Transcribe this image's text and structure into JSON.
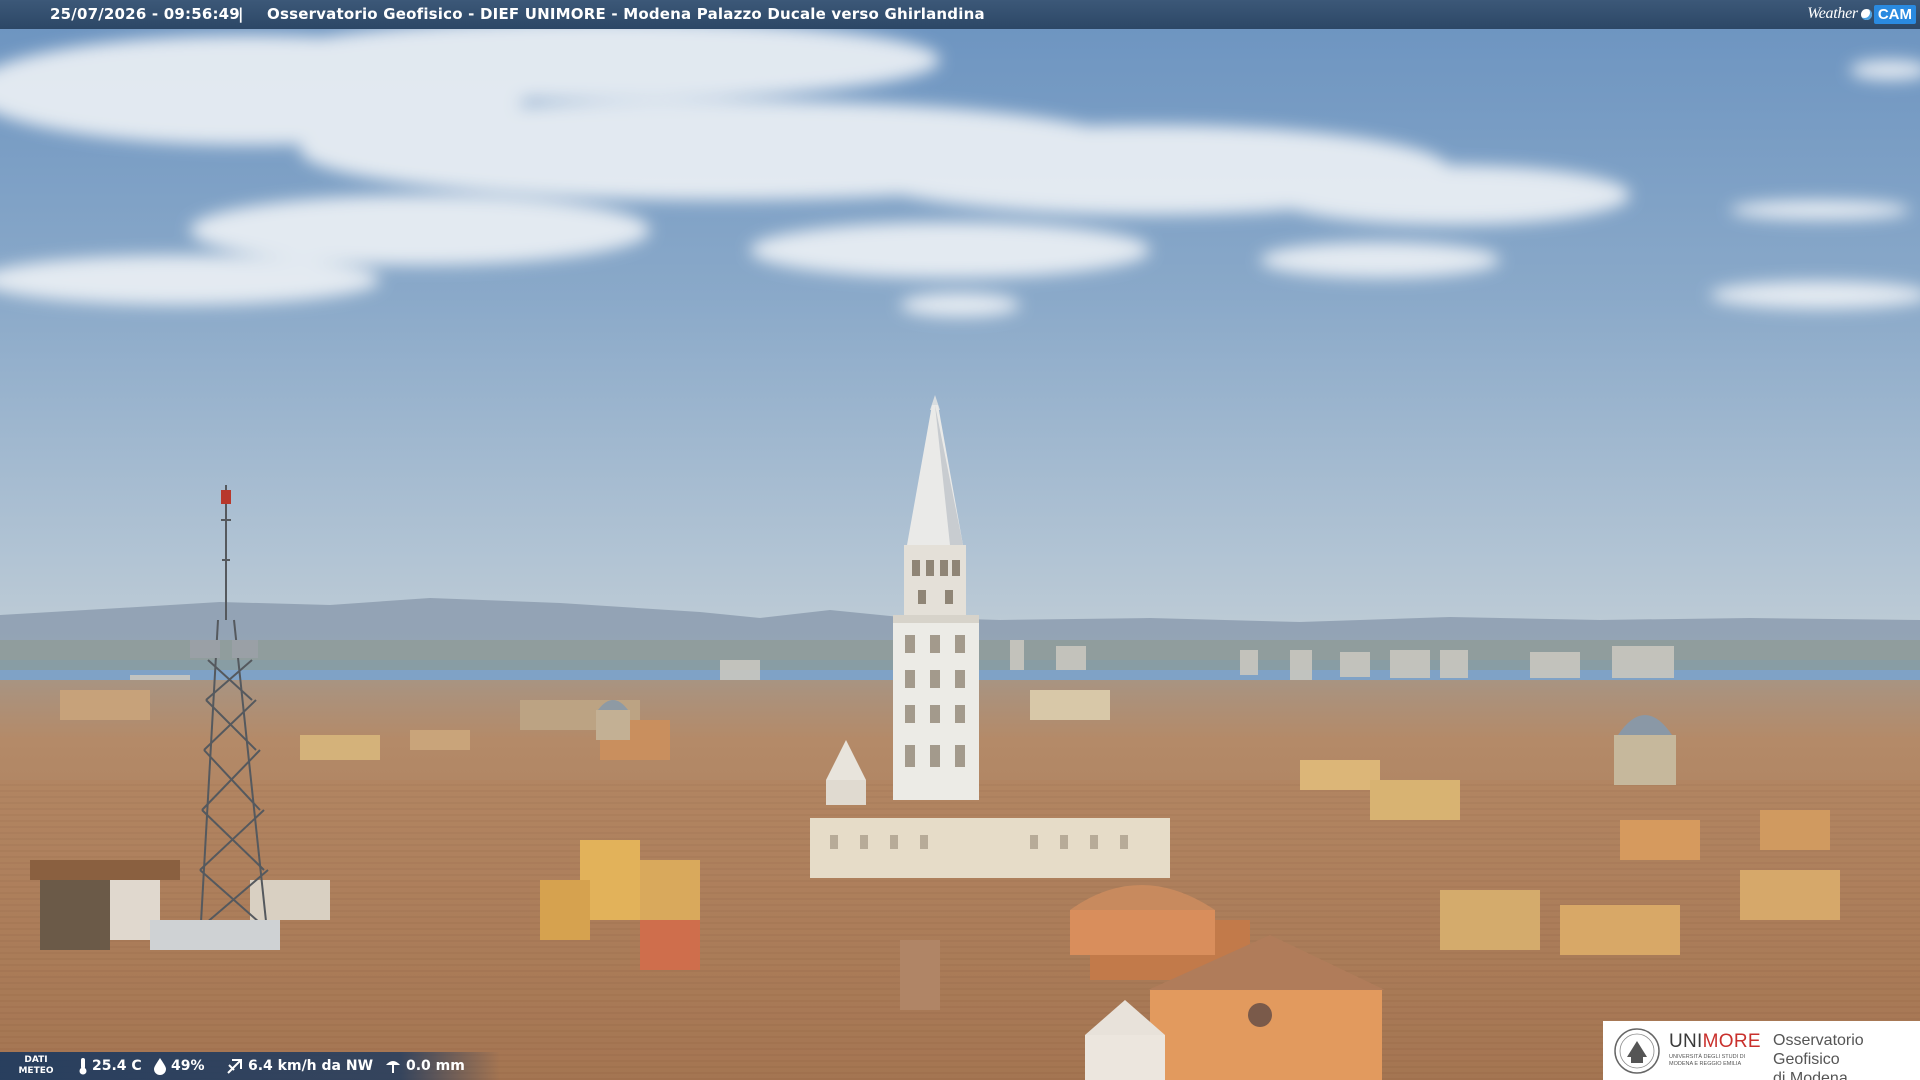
{
  "caption": {
    "timestamp": "25/07/2026 - 09:56:49",
    "separator": "|",
    "title": "Osservatorio Geofisico - DIEF UNIMORE - Modena Palazzo Ducale verso Ghirlandina"
  },
  "watermark": {
    "weather": "Weather",
    "cam": "CAM",
    "icon": "weathercam-logo"
  },
  "weather": {
    "label": "DATI\nMETEO",
    "temperature": "25.4 C",
    "humidity": "49%",
    "wind": "6.4 km/h da NW",
    "rain": "0.0 mm",
    "icons": [
      "thermometer-icon",
      "humidity-drop-icon",
      "wind-icon",
      "rain-gauge-icon"
    ]
  },
  "logo": {
    "brand_uni": "UNI",
    "brand_more": "MORE",
    "university": "UNIVERSITÀ DEGLI STUDI DI MODENA E REGGIO EMILIA",
    "observatory": "Osservatorio Geofisico\ndi Modena"
  },
  "colors": {
    "sky_top": "#6e95c2",
    "sky_horizon": "#b4c6d6",
    "roof": "#b98a63",
    "caption_bar": "#34506f",
    "brand_red": "#c9302c"
  }
}
